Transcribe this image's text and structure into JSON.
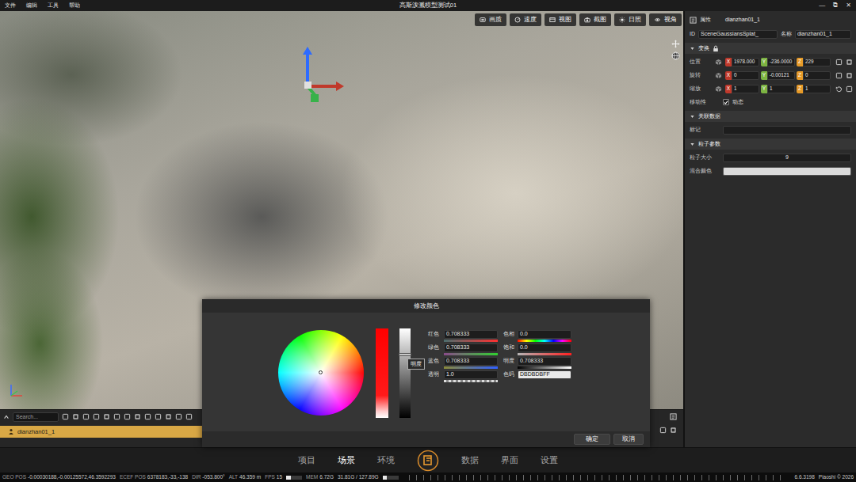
{
  "window": {
    "title": "高斯泼溅模型测试01",
    "controls": [
      "—",
      "⧉",
      "✕"
    ]
  },
  "menu": [
    "文件",
    "编辑",
    "工具",
    "帮助"
  ],
  "viewport": {
    "toolbar": [
      "画质",
      "速度",
      "视图",
      "截图",
      "日照",
      "视角"
    ]
  },
  "properties": {
    "title": "属性",
    "object_name": "dianzhan01_1",
    "id_label": "ID",
    "id_value": "SceneGaussiansSplat_",
    "name_label": "名称",
    "name_value": "dianzhan01_1",
    "transform": {
      "title": "变换",
      "expanded": true,
      "rows": [
        {
          "label": "位置",
          "values": [
            {
              "axis": "X",
              "value": "1978.000",
              "color": "#c0392b"
            },
            {
              "axis": "Y",
              "value": "-236.0000",
              "color": "#7cb342"
            },
            {
              "axis": "Z",
              "value": "229",
              "color": "#e69a28"
            }
          ]
        },
        {
          "label": "旋转",
          "values": [
            {
              "axis": "X",
              "value": "0",
              "color": "#c0392b"
            },
            {
              "axis": "Y",
              "value": "-0.00121",
              "color": "#7cb342"
            },
            {
              "axis": "Z",
              "value": "0",
              "color": "#e69a28"
            }
          ]
        },
        {
          "label": "缩放",
          "values": [
            {
              "axis": "X",
              "value": "1",
              "color": "#c0392b"
            },
            {
              "axis": "Y",
              "value": "1",
              "color": "#7cb342"
            },
            {
              "axis": "Z",
              "value": "1",
              "color": "#e69a28"
            }
          ]
        }
      ],
      "mobility": {
        "label": "移动性",
        "option": "动态",
        "checked": true
      }
    },
    "linked_data": {
      "title": "关联数据",
      "expanded": true,
      "tag_label": "标记"
    },
    "particles": {
      "title": "粒子参数",
      "expanded": true,
      "size_label": "粒子大小",
      "size_value": "9",
      "blend_label": "混合颜色",
      "blend_color": "#dbdbdb"
    }
  },
  "color_dialog": {
    "title": "修改颜色",
    "tooltip": "明度",
    "lightness_level": 0.708333,
    "fields_left": [
      {
        "label": "红色",
        "value": "0.708333",
        "kind": "red"
      },
      {
        "label": "绿色",
        "value": "0.708333",
        "kind": "green"
      },
      {
        "label": "蓝色",
        "value": "0.708333",
        "kind": "blue"
      },
      {
        "label": "透明",
        "value": "1.0",
        "kind": "alpha"
      }
    ],
    "fields_right": [
      {
        "label": "色相",
        "value": "0.0",
        "kind": "hue"
      },
      {
        "label": "饱和",
        "value": "0.0",
        "kind": "saturation"
      },
      {
        "label": "明度",
        "value": "0.708333",
        "kind": "lightness"
      },
      {
        "label": "色码",
        "value": "DBDBDBFF",
        "kind": "code"
      }
    ],
    "buttons": [
      "确定",
      "取消"
    ]
  },
  "scene_tree": {
    "search_placeholder": "Search...",
    "items": [
      {
        "label": "dianzhan01_1",
        "selected": true
      }
    ]
  },
  "bottom_nav": {
    "left": [
      {
        "label": "项目",
        "selected": false
      },
      {
        "label": "场景",
        "selected": true
      },
      {
        "label": "环境",
        "selected": false
      }
    ],
    "right": [
      {
        "label": "数据",
        "selected": false
      },
      {
        "label": "界面",
        "selected": false
      },
      {
        "label": "设置",
        "selected": false
      }
    ]
  },
  "status_bar": {
    "items": [
      {
        "kind": "pair",
        "label": "GEO POS",
        "value": "-0.00030188,-0.00125572,46.3592293"
      },
      {
        "kind": "pair",
        "label": "ECEF POS",
        "value": "6378183,-33,-138"
      },
      {
        "kind": "pair",
        "label": "DIR",
        "value": "-053.800°"
      },
      {
        "kind": "pair",
        "label": "ALT",
        "value": "46.359 m"
      },
      {
        "kind": "pair",
        "label": "FPS",
        "value": "15"
      },
      {
        "kind": "meter",
        "level": 0.3
      },
      {
        "kind": "pair",
        "label": "MEM",
        "value": "6.72G"
      },
      {
        "kind": "text",
        "value": "31.81G / 127.89G"
      },
      {
        "kind": "meter",
        "level": 0.25
      }
    ],
    "version": "6.6.3198",
    "copyright": "Piaoshi © 2026"
  }
}
